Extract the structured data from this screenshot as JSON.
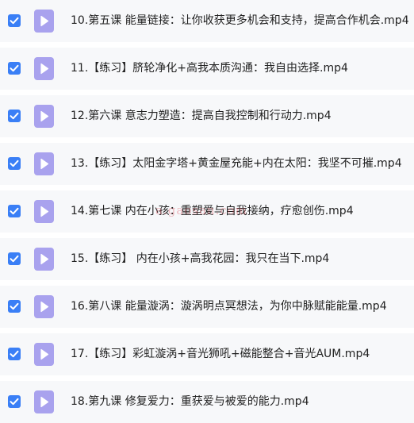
{
  "colors": {
    "row_background": "#f7f8fa",
    "checkbox": "#3a7ff6",
    "video_icon": "#a9a2ee",
    "text": "#222222",
    "watermark": "#dc4650"
  },
  "icons": {
    "checkbox": "checkmark-icon",
    "file": "video-file-play-icon"
  },
  "files": [
    {
      "name": "10.第五课 能量链接：让你收获更多机会和支持，提高合作机会.mp4",
      "checked": true
    },
    {
      "name": "11.【练习】脐轮净化+高我本质沟通：我自由选择.mp4",
      "checked": true
    },
    {
      "name": "12.第六课 意志力塑造：提高自我控制和行动力.mp4",
      "checked": true
    },
    {
      "name": "13.【练习】太阳金字塔+黄金屋充能+内在太阳：我坚不可摧.mp4",
      "checked": true
    },
    {
      "name": "14.第七课 内在小孩：重塑爱与自我接纳，疗愈创伤.mp4",
      "checked": true
    },
    {
      "name": "15.【练习】 内在小孩+高我花园：我只在当下.mp4",
      "checked": true
    },
    {
      "name": "16.第八课 能量漩涡：漩涡明点冥想法，为你中脉赋能能量.mp4",
      "checked": true
    },
    {
      "name": "17.【练习】彩虹漩涡+音光狮吼+磁能整合+音光AUM.mp4",
      "checked": true
    },
    {
      "name": "18.第九课 修复爱力：重获爱与被爱的能力.mp4",
      "checked": true
    }
  ],
  "watermark": {
    "text": "a.gaosan.com"
  }
}
